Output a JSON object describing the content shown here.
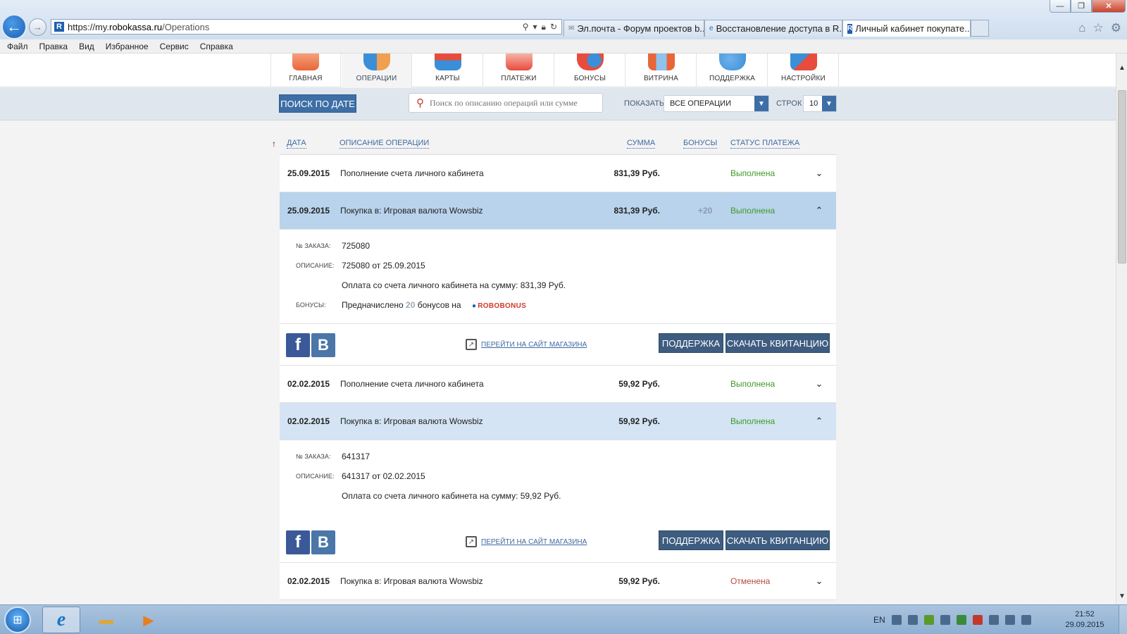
{
  "browser": {
    "url_prefix": "https://my.",
    "url_domain": "robokassa.ru",
    "url_path": "/Operations",
    "tabs": [
      {
        "label": "Эл.почта - Форум проектов b..."
      },
      {
        "label": "Восстановление доступа в R..."
      },
      {
        "label": "Личный кабинет покупате...",
        "close": "✕"
      }
    ],
    "window_buttons": {
      "minimize": "—",
      "restore": "❐",
      "close": "✕"
    }
  },
  "menubar": [
    "Файл",
    "Правка",
    "Вид",
    "Избранное",
    "Сервис",
    "Справка"
  ],
  "topnav": [
    {
      "label": "ГЛАВНАЯ",
      "color": "#e8663a"
    },
    {
      "label": "ОПЕРАЦИИ",
      "color": "#3a8fd8"
    },
    {
      "label": "КАРТЫ",
      "color": "#e74c3c"
    },
    {
      "label": "ПЛАТЕЖИ",
      "color": "#e74c3c"
    },
    {
      "label": "БОНУСЫ",
      "color": "#e74c3c"
    },
    {
      "label": "ВИТРИНА",
      "color": "#e8663a"
    },
    {
      "label": "ПОДДЕРЖКА",
      "color": "#3a8fd8"
    },
    {
      "label": "НАСТРОЙКИ",
      "color": "#e74c3c"
    }
  ],
  "filters": {
    "search_by_date": "ПОИСК ПО ДАТЕ",
    "search_placeholder": "Поиск по описанию операций или сумме",
    "show_label": "ПОКАЗАТЬ",
    "show_value": "ВСЕ ОПЕРАЦИИ",
    "rows_label": "СТРОК",
    "rows_value": "10"
  },
  "table": {
    "headers": {
      "date": "ДАТА",
      "description": "ОПИСАНИЕ ОПЕРАЦИИ",
      "amount": "СУММА",
      "bonuses": "БОНУСЫ",
      "status": "СТАТУС ПЛАТЕЖА"
    },
    "rows": [
      {
        "date": "25.09.2015",
        "description": "Пополнение счета личного кабинета",
        "amount": "831,39 Руб.",
        "bonus": "",
        "status": "Выполнена"
      },
      {
        "date": "25.09.2015",
        "description": "Покупка в: Игровая валюта Wowsbiz",
        "amount": "831,39 Руб.",
        "bonus": "+20",
        "status": "Выполнена"
      },
      {
        "date": "02.02.2015",
        "description": "Пополнение счета личного кабинета",
        "amount": "59,92 Руб.",
        "bonus": "",
        "status": "Выполнена"
      },
      {
        "date": "02.02.2015",
        "description": "Покупка в: Игровая валюта Wowsbiz",
        "amount": "59,92 Руб.",
        "bonus": "",
        "status": "Выполнена"
      },
      {
        "date": "02.02.2015",
        "description": "Покупка в: Игровая валюта Wowsbiz",
        "amount": "59,92 Руб.",
        "bonus": "",
        "status": "Отменена"
      }
    ],
    "details": [
      {
        "order_label": "№ ЗАКАЗА:",
        "order": "725080",
        "desc_label": "ОПИСАНИЕ:",
        "desc": "725080 от 25.09.2015",
        "payment": "Оплата со счета личного кабинета на сумму: 831,39 Руб.",
        "bonus_label": "БОНУСЫ:",
        "bonus_prefix": "Предначислено",
        "bonus_count": "20",
        "bonus_suffix": "бонусов на",
        "bonus_brand": "ROBOBONUS"
      },
      {
        "order_label": "№ ЗАКАЗА:",
        "order": "641317",
        "desc_label": "ОПИСАНИЕ:",
        "desc": "641317 от 02.02.2015",
        "payment": "Оплата со счета личного кабинета на сумму: 59,92 Руб."
      }
    ],
    "actions": {
      "facebook": "f",
      "vk": "B",
      "shop_link": "ПЕРЕЙТИ НА САЙТ МАГАЗИНА",
      "support": "ПОДДЕРЖКА",
      "receipt": "СКАЧАТЬ КВИТАНЦИЮ"
    }
  },
  "taskbar": {
    "lang": "EN",
    "time": "21:52",
    "date": "29.09.2015"
  }
}
